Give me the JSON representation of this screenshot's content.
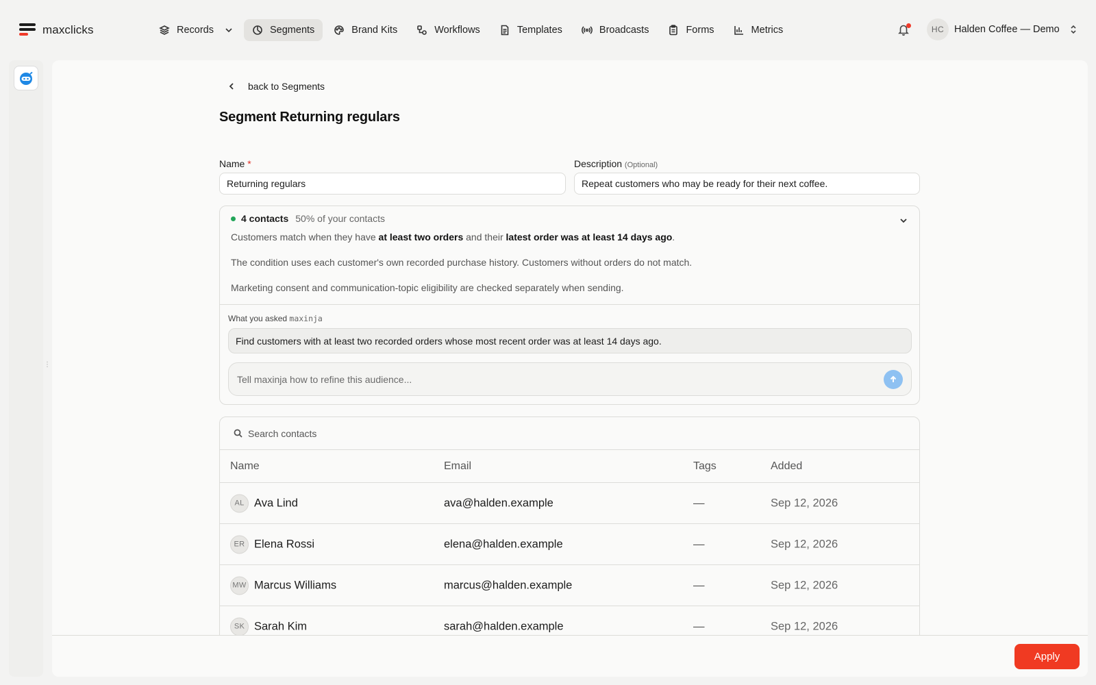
{
  "app": {
    "logo_text": "maxclicks"
  },
  "nav": {
    "items": [
      {
        "label": "Records",
        "icon": "layers-icon"
      },
      {
        "label": "Segments",
        "icon": "pie-icon",
        "active": true
      },
      {
        "label": "Brand Kits",
        "icon": "palette-icon"
      },
      {
        "label": "Workflows",
        "icon": "workflow-icon"
      },
      {
        "label": "Templates",
        "icon": "document-icon"
      },
      {
        "label": "Broadcasts",
        "icon": "broadcast-icon"
      },
      {
        "label": "Forms",
        "icon": "clipboard-icon"
      },
      {
        "label": "Metrics",
        "icon": "bar-chart-icon"
      }
    ]
  },
  "account": {
    "initials": "HC",
    "name": "Halden Coffee — Demo"
  },
  "page": {
    "back_label": "back to Segments",
    "title": "Segment Returning regulars"
  },
  "form": {
    "name_label": "Name",
    "name_required": "*",
    "name_value": "Returning regulars",
    "description_label": "Description",
    "description_optional": "(Optional)",
    "description_value": "Repeat customers who may be ready for their next coffee."
  },
  "summary": {
    "count": "4 contacts",
    "percent": "50% of your contacts",
    "line1_a": "Customers match when they have ",
    "line1_b": "at least two orders",
    "line1_c": " and their ",
    "line1_d": "latest order was at least 14 days ago",
    "line1_e": ".",
    "line2": "The condition uses each customer's own recorded purchase history. Customers without orders do not match.",
    "line3": "Marketing consent and communication-topic eligibility are checked separately when sending.",
    "ask_label": "What you asked",
    "ask_agent": "maxinja",
    "ask_query": "Find customers with at least two recorded orders whose most recent order was at least 14 days ago.",
    "refine_placeholder": "Tell maxinja how to refine this audience..."
  },
  "contacts": {
    "search_placeholder": "Search contacts",
    "columns": [
      "Name",
      "Email",
      "Tags",
      "Added"
    ],
    "rows": [
      {
        "initials": "AL",
        "name": "Ava Lind",
        "email": "ava@halden.example",
        "tags": "—",
        "added": "Sep 12, 2026"
      },
      {
        "initials": "ER",
        "name": "Elena Rossi",
        "email": "elena@halden.example",
        "tags": "—",
        "added": "Sep 12, 2026"
      },
      {
        "initials": "MW",
        "name": "Marcus Williams",
        "email": "marcus@halden.example",
        "tags": "—",
        "added": "Sep 12, 2026"
      },
      {
        "initials": "SK",
        "name": "Sarah Kim",
        "email": "sarah@halden.example",
        "tags": "—",
        "added": "Sep 12, 2026"
      }
    ]
  },
  "footer": {
    "apply_label": "Apply"
  },
  "colors": {
    "accent": "#f03a22",
    "status_green": "#22a559",
    "send_blue": "#8ec1f2"
  }
}
